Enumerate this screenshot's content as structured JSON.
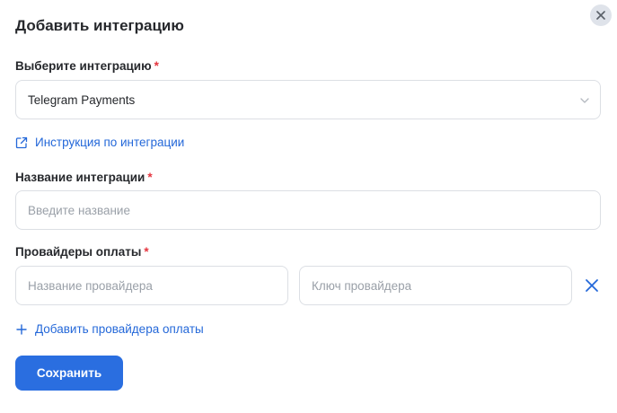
{
  "dialog": {
    "title": "Добавить интеграцию",
    "close_icon": "close-icon"
  },
  "integration_select": {
    "label": "Выберите интеграцию",
    "required_mark": "*",
    "value": "Telegram Payments",
    "icon": "chevron-down-icon"
  },
  "instruction_link": {
    "label": "Инструкция по интеграции",
    "icon": "external-link-icon"
  },
  "integration_name": {
    "label": "Название интеграции",
    "required_mark": "*",
    "placeholder": "Введите название"
  },
  "providers": {
    "label": "Провайдеры оплаты",
    "required_mark": "*",
    "rows": [
      {
        "name_placeholder": "Название провайдера",
        "key_placeholder": "Ключ провайдера",
        "remove_icon": "close-icon"
      }
    ],
    "add_label": "Добавить провайдера оплаты",
    "add_icon": "plus-icon"
  },
  "actions": {
    "save_label": "Сохранить"
  },
  "colors": {
    "accent": "#2a6ee0",
    "link": "#2468d9",
    "required": "#e5353f",
    "border": "#dcdfe4"
  }
}
